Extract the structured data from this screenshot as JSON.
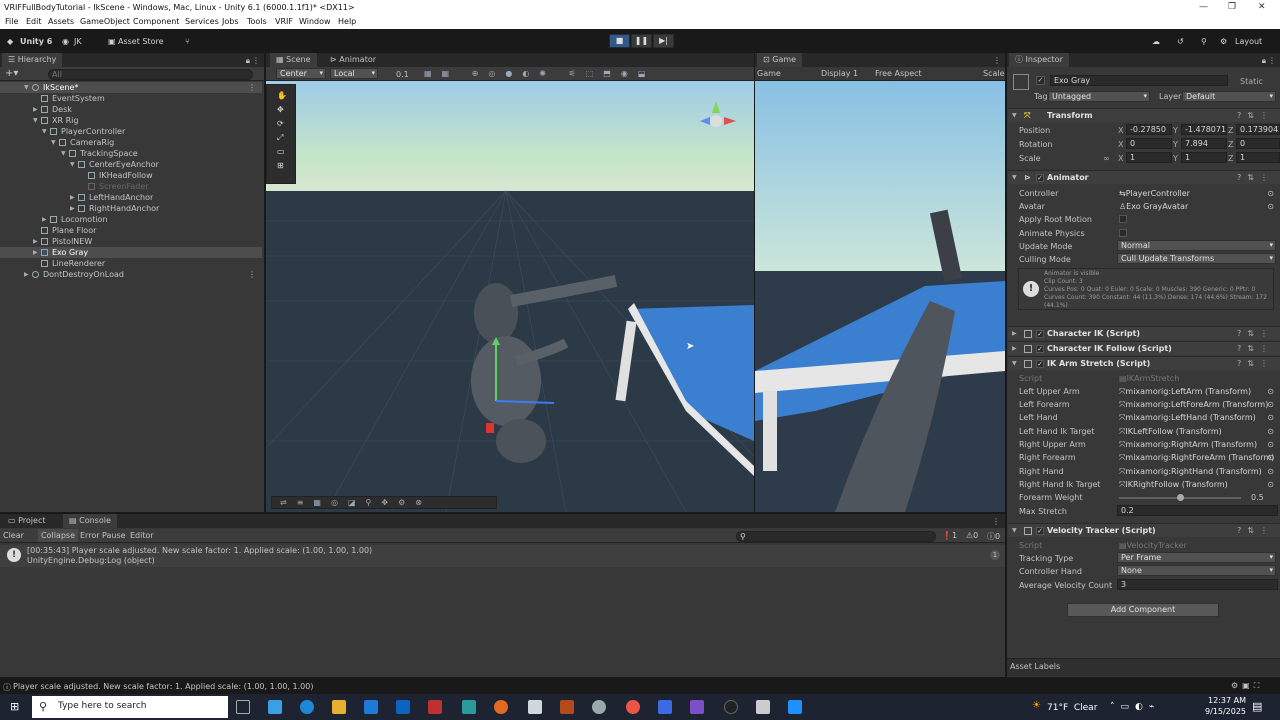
{
  "window": {
    "title": "VRIFFullBodyTutorial - IkScene - Windows, Mac, Linux - Unity 6.1 (6000.1.1f1)* <DX11>"
  },
  "menu": [
    "File",
    "Edit",
    "Assets",
    "GameObject",
    "Component",
    "Services",
    "Jobs",
    "Tools",
    "VRIF",
    "Window",
    "Help"
  ],
  "toolbar": {
    "unity_label": "Unity 6",
    "account": "JK",
    "asset_store": "Asset Store",
    "layout": "Layout"
  },
  "hierarchy": {
    "tab": "Hierarchy",
    "search_placeholder": "All",
    "items": [
      {
        "label": "IkScene*"
      },
      {
        "label": "EventSystem"
      },
      {
        "label": "Desk"
      },
      {
        "label": "XR Rig"
      },
      {
        "label": "PlayerController"
      },
      {
        "label": "CameraRig"
      },
      {
        "label": "TrackingSpace"
      },
      {
        "label": "CenterEyeAnchor"
      },
      {
        "label": "IKHeadFollow"
      },
      {
        "label": "ScreenFader"
      },
      {
        "label": "LeftHandAnchor"
      },
      {
        "label": "RightHandAnchor"
      },
      {
        "label": "Locomotion"
      },
      {
        "label": "Plane Floor"
      },
      {
        "label": "PistolNEW"
      },
      {
        "label": "Exo Gray"
      },
      {
        "label": "LineRenderer"
      },
      {
        "label": "DontDestroyOnLoad"
      }
    ]
  },
  "scene": {
    "tabs": [
      "Scene",
      "Animator"
    ],
    "pivot": "Center",
    "space": "Local",
    "snap": "0.1"
  },
  "game": {
    "tab": "Game",
    "mode": "Game",
    "display": "Display 1",
    "aspect": "Free Aspect",
    "scale": "Scale"
  },
  "inspector": {
    "tab": "Inspector",
    "object_name": "Exo Gray",
    "static_label": "Static",
    "tag_label": "Tag",
    "tag_value": "Untagged",
    "layer_label": "Layer",
    "layer_value": "Default",
    "transform": {
      "header": "Transform",
      "position_label": "Position",
      "position": {
        "x": "-0.27850",
        "y": "-1.478071",
        "z": "0.1739042"
      },
      "rotation_label": "Rotation",
      "rotation": {
        "x": "0",
        "y": "7.894",
        "z": "0"
      },
      "scale_label": "Scale",
      "scale": {
        "x": "1",
        "y": "1",
        "z": "1"
      }
    },
    "animator": {
      "header": "Animator",
      "controller_label": "Controller",
      "controller_value": "PlayerController",
      "avatar_label": "Avatar",
      "avatar_value": "Exo GrayAvatar",
      "apply_root_motion_label": "Apply Root Motion",
      "animate_physics_label": "Animate Physics",
      "update_mode_label": "Update Mode",
      "update_mode_value": "Normal",
      "culling_mode_label": "Culling Mode",
      "culling_mode_value": "Cull Update Transforms",
      "info_text": "Animator is visible\nClip Count: 3\nCurves Pos: 0 Quat: 0 Euler: 0 Scale: 0 Muscles: 390 Generic: 0 PPtr: 0\nCurves Count: 390 Constant: 44 (11.3%) Dense: 174 (44.6%) Stream: 172 (44.1%)"
    },
    "character_ik": "Character IK (Script)",
    "character_ik_follow": "Character IK Follow (Script)",
    "ik_arm_stretch": {
      "header": "IK Arm Stretch (Script)",
      "script_label": "Script",
      "script_value": "IKArmStretch",
      "fields": [
        {
          "label": "Left Upper Arm",
          "value": "mixamorig:LeftArm (Transform)"
        },
        {
          "label": "Left Forearm",
          "value": "mixamorig:LeftForeArm (Transform)"
        },
        {
          "label": "Left Hand",
          "value": "mixamorig:LeftHand (Transform)"
        },
        {
          "label": "Left Hand Ik Target",
          "value": "IKLeftFollow (Transform)"
        },
        {
          "label": "Right Upper Arm",
          "value": "mixamorig:RightArm (Transform)"
        },
        {
          "label": "Right Forearm",
          "value": "mixamorig:RightForeArm (Transform)"
        },
        {
          "label": "Right Hand",
          "value": "mixamorig:RightHand (Transform)"
        },
        {
          "label": "Right Hand Ik Target",
          "value": "IKRightFollow (Transform)"
        }
      ],
      "forearm_weight_label": "Forearm Weight",
      "forearm_weight_value": "0.5",
      "forearm_weight": 0.5,
      "max_stretch_label": "Max Stretch",
      "max_stretch_value": "0.2"
    },
    "velocity_tracker": {
      "header": "Velocity Tracker (Script)",
      "script_label": "Script",
      "script_value": "VelocityTracker",
      "tracking_type_label": "Tracking Type",
      "tracking_type_value": "Per Frame",
      "controller_hand_label": "Controller Hand",
      "controller_hand_value": "None",
      "avg_velocity_label": "Average Velocity Count",
      "avg_velocity_value": "3"
    },
    "add_component": "Add Component",
    "asset_labels": "Asset Labels"
  },
  "console": {
    "tabs": [
      "Project",
      "Console"
    ],
    "buttons": [
      "Clear",
      "Collapse",
      "Error Pause",
      "Editor"
    ],
    "log_line1": "[00:35:43] Player scale adjusted. New scale factor: 1. Applied scale: (1.00, 1.00, 1.00)",
    "log_line2": "UnityEngine.Debug:Log (object)",
    "count_errors": "1",
    "count_warn": "0",
    "count_info": "0"
  },
  "statusbar": {
    "text": "Player scale adjusted. New scale factor: 1. Applied scale: (1.00, 1.00, 1.00)"
  },
  "taskbar": {
    "search_placeholder": "Type here to search",
    "weather": "71°F  Clear",
    "time": "12:37 AM",
    "date": "9/15/2025"
  },
  "colors": {
    "accent": "#2f5a8a",
    "table_blue": "#3a7fd0",
    "sky_top": "#8fc3e6"
  }
}
